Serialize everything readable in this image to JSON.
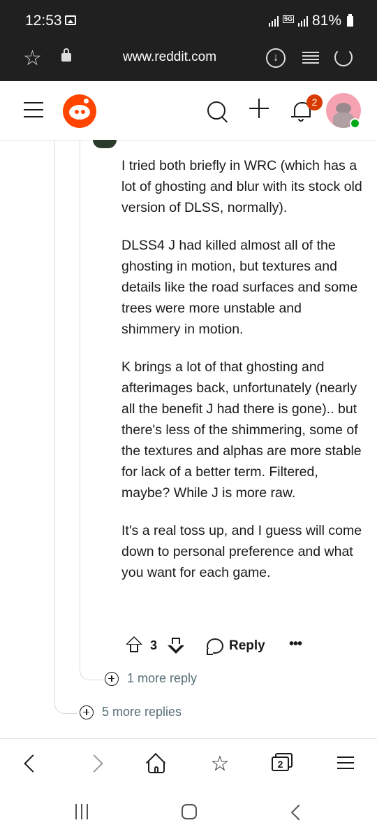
{
  "status_bar": {
    "time": "12:53",
    "network": "5G",
    "battery": "81%"
  },
  "browser": {
    "url": "www.reddit.com",
    "tab_count": "2"
  },
  "header": {
    "notification_count": "2",
    "brand_color": "#ff4500"
  },
  "comment": {
    "paragraphs": [
      "I tried both briefly in WRC (which has a lot of ghosting and blur with its stock old version of DLSS, normally).",
      "DLSS4 J had killed almost all of the ghosting in motion, but textures and details like the road surfaces and some trees were more unstable and shimmery in motion.",
      "K brings a lot of that ghosting and afterimages back, unfortunately (nearly all the benefit J had there is gone).. but there's less of the shimmering, some of the textures and alphas are more stable for lack of a better term. Filtered, maybe? While J is more raw.",
      "It's a real toss up, and I guess will come down to personal preference and what you want for each game."
    ],
    "score": "3",
    "reply_label": "Reply",
    "more_label": "•••"
  },
  "thread": {
    "more_reply_label": "1 more reply",
    "more_replies_label": "5 more replies"
  }
}
